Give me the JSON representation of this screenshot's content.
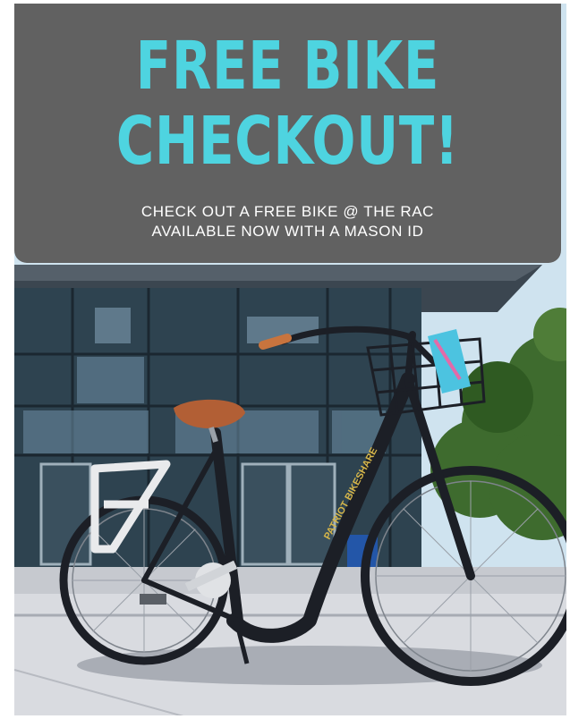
{
  "headline": {
    "line1": "FREE BIKE",
    "line2": "CHECKOUT!"
  },
  "subheadline": {
    "line1": "CHECK OUT A FREE BIKE @ THE RAC",
    "line2": "AVAILABLE NOW WITH A MASON ID"
  },
  "bike": {
    "chainguard_text": "PATRIOT BIKESHARE"
  },
  "colors": {
    "banner": "#616161",
    "headline": "#4ed4e0",
    "subheadline": "#ffffff",
    "sky": "#cfe3ef",
    "building_glass": "#2e4350",
    "saddle": "#b25f35",
    "bike_frame": "#1c1f26",
    "trees": "#3e6b2e",
    "ground": "#d9dbe0"
  }
}
